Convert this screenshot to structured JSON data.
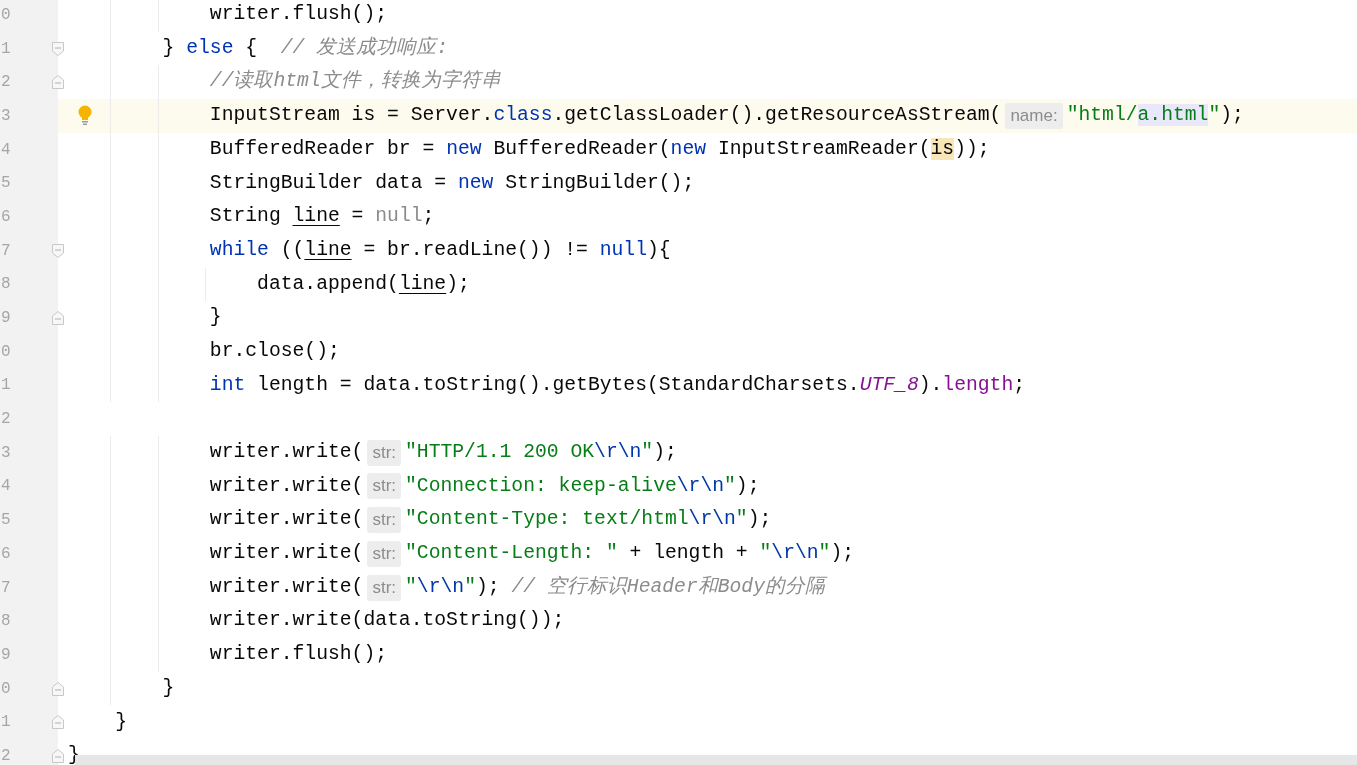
{
  "editor": {
    "lines": [
      {
        "number": "0",
        "highlighted": false,
        "bulb": false,
        "fold_start": false,
        "fold_end": false,
        "tokens": [
          {
            "kind": "plain",
            "text": "            writer.flush();"
          }
        ]
      },
      {
        "number": "1",
        "highlighted": false,
        "bulb": false,
        "fold_start": true,
        "fold_end": false,
        "tokens": [
          {
            "kind": "plain",
            "text": "        } "
          },
          {
            "kind": "keyword",
            "text": "else"
          },
          {
            "kind": "plain",
            "text": " {  "
          },
          {
            "kind": "comment",
            "text": "// 发送成功响应:"
          }
        ]
      },
      {
        "number": "2",
        "highlighted": false,
        "bulb": false,
        "fold_start": false,
        "fold_end": true,
        "tokens": [
          {
            "kind": "comment",
            "text": "            //读取html文件，转换为字符串"
          }
        ]
      },
      {
        "number": "3",
        "highlighted": true,
        "bulb": true,
        "fold_start": false,
        "fold_end": false,
        "tokens": [
          {
            "kind": "plain",
            "text": "            InputStream is = Server."
          },
          {
            "kind": "keyword",
            "text": "class"
          },
          {
            "kind": "plain",
            "text": ".getClassLoader().getResourceAsStream("
          },
          {
            "kind": "hint",
            "text": "name:"
          },
          {
            "kind": "string",
            "text": "\"html/"
          },
          {
            "kind": "match",
            "text": "a.html"
          },
          {
            "kind": "string",
            "text": "\""
          },
          {
            "kind": "plain",
            "text": ");"
          }
        ]
      },
      {
        "number": "4",
        "highlighted": false,
        "bulb": false,
        "fold_start": false,
        "fold_end": false,
        "tokens": [
          {
            "kind": "plain",
            "text": "            BufferedReader br = "
          },
          {
            "kind": "keyword",
            "text": "new"
          },
          {
            "kind": "plain",
            "text": " BufferedReader("
          },
          {
            "kind": "keyword",
            "text": "new"
          },
          {
            "kind": "plain",
            "text": " InputStreamReader("
          },
          {
            "kind": "usage",
            "text": "is"
          },
          {
            "kind": "plain",
            "text": "));"
          }
        ]
      },
      {
        "number": "5",
        "highlighted": false,
        "bulb": false,
        "fold_start": false,
        "fold_end": false,
        "tokens": [
          {
            "kind": "plain",
            "text": "            StringBuilder data = "
          },
          {
            "kind": "keyword",
            "text": "new"
          },
          {
            "kind": "plain",
            "text": " StringBuilder();"
          }
        ]
      },
      {
        "number": "6",
        "highlighted": false,
        "bulb": false,
        "fold_start": false,
        "fold_end": false,
        "tokens": [
          {
            "kind": "plain",
            "text": "            String "
          },
          {
            "kind": "reassigned",
            "text": "line"
          },
          {
            "kind": "plain",
            "text": " = "
          },
          {
            "kind": "redundant",
            "text": "null"
          },
          {
            "kind": "plain",
            "text": ";"
          }
        ]
      },
      {
        "number": "7",
        "highlighted": false,
        "bulb": false,
        "fold_start": true,
        "fold_end": false,
        "tokens": [
          {
            "kind": "keyword",
            "text": "            while"
          },
          {
            "kind": "plain",
            "text": " (("
          },
          {
            "kind": "reassigned",
            "text": "line"
          },
          {
            "kind": "plain",
            "text": " = br.readLine()) != "
          },
          {
            "kind": "keyword",
            "text": "null"
          },
          {
            "kind": "plain",
            "text": "){"
          }
        ]
      },
      {
        "number": "8",
        "highlighted": false,
        "bulb": false,
        "fold_start": false,
        "fold_end": false,
        "tokens": [
          {
            "kind": "plain",
            "text": "                data.append("
          },
          {
            "kind": "reassigned",
            "text": "line"
          },
          {
            "kind": "plain",
            "text": ");"
          }
        ]
      },
      {
        "number": "9",
        "highlighted": false,
        "bulb": false,
        "fold_start": false,
        "fold_end": true,
        "tokens": [
          {
            "kind": "plain",
            "text": "            }"
          }
        ]
      },
      {
        "number": "0",
        "highlighted": false,
        "bulb": false,
        "fold_start": false,
        "fold_end": false,
        "tokens": [
          {
            "kind": "plain",
            "text": "            br.close();"
          }
        ]
      },
      {
        "number": "1",
        "highlighted": false,
        "bulb": false,
        "fold_start": false,
        "fold_end": false,
        "tokens": [
          {
            "kind": "keyword",
            "text": "            int"
          },
          {
            "kind": "plain",
            "text": " length = data.toString().getBytes(StandardCharsets."
          },
          {
            "kind": "constant",
            "text": "UTF_8"
          },
          {
            "kind": "plain",
            "text": ")."
          },
          {
            "kind": "field",
            "text": "length"
          },
          {
            "kind": "plain",
            "text": ";"
          }
        ]
      },
      {
        "number": "2",
        "highlighted": false,
        "bulb": false,
        "fold_start": false,
        "fold_end": false
      },
      {
        "number": "3",
        "highlighted": false,
        "bulb": false,
        "fold_start": false,
        "fold_end": false,
        "tokens": [
          {
            "kind": "plain",
            "text": "            writer.write("
          },
          {
            "kind": "hint",
            "text": "str:"
          },
          {
            "kind": "string",
            "text": "\"HTTP/1.1 200 OK"
          },
          {
            "kind": "escape",
            "text": "\\r\\n"
          },
          {
            "kind": "string",
            "text": "\""
          },
          {
            "kind": "plain",
            "text": ");"
          }
        ]
      },
      {
        "number": "4",
        "highlighted": false,
        "bulb": false,
        "fold_start": false,
        "fold_end": false,
        "tokens": [
          {
            "kind": "plain",
            "text": "            writer.write("
          },
          {
            "kind": "hint",
            "text": "str:"
          },
          {
            "kind": "string",
            "text": "\"Connection: keep-alive"
          },
          {
            "kind": "escape",
            "text": "\\r\\n"
          },
          {
            "kind": "string",
            "text": "\""
          },
          {
            "kind": "plain",
            "text": ");"
          }
        ]
      },
      {
        "number": "5",
        "highlighted": false,
        "bulb": false,
        "fold_start": false,
        "fold_end": false,
        "tokens": [
          {
            "kind": "plain",
            "text": "            writer.write("
          },
          {
            "kind": "hint",
            "text": "str:"
          },
          {
            "kind": "string",
            "text": "\"Content-Type: text/html"
          },
          {
            "kind": "escape",
            "text": "\\r\\n"
          },
          {
            "kind": "string",
            "text": "\""
          },
          {
            "kind": "plain",
            "text": ");"
          }
        ]
      },
      {
        "number": "6",
        "highlighted": false,
        "bulb": false,
        "fold_start": false,
        "fold_end": false,
        "tokens": [
          {
            "kind": "plain",
            "text": "            writer.write("
          },
          {
            "kind": "hint",
            "text": "str:"
          },
          {
            "kind": "string",
            "text": "\"Content-Length: \""
          },
          {
            "kind": "plain",
            "text": " + length + "
          },
          {
            "kind": "string",
            "text": "\""
          },
          {
            "kind": "escape",
            "text": "\\r\\n"
          },
          {
            "kind": "string",
            "text": "\""
          },
          {
            "kind": "plain",
            "text": ");"
          }
        ]
      },
      {
        "number": "7",
        "highlighted": false,
        "bulb": false,
        "fold_start": false,
        "fold_end": false,
        "tokens": [
          {
            "kind": "plain",
            "text": "            writer.write("
          },
          {
            "kind": "hint",
            "text": "str:"
          },
          {
            "kind": "string",
            "text": "\""
          },
          {
            "kind": "escape",
            "text": "\\r\\n"
          },
          {
            "kind": "string",
            "text": "\""
          },
          {
            "kind": "plain",
            "text": "); "
          },
          {
            "kind": "comment",
            "text": "// 空行标识Header和Body的分隔"
          }
        ]
      },
      {
        "number": "8",
        "highlighted": false,
        "bulb": false,
        "fold_start": false,
        "fold_end": false,
        "tokens": [
          {
            "kind": "plain",
            "text": "            writer.write(data.toString());"
          }
        ]
      },
      {
        "number": "9",
        "highlighted": false,
        "bulb": false,
        "fold_start": false,
        "fold_end": false,
        "tokens": [
          {
            "kind": "plain",
            "text": "            writer.flush();"
          }
        ]
      },
      {
        "number": "0",
        "highlighted": false,
        "bulb": false,
        "fold_start": false,
        "fold_end": true,
        "tokens": [
          {
            "kind": "plain",
            "text": "        }"
          }
        ]
      },
      {
        "number": "1",
        "highlighted": false,
        "bulb": false,
        "fold_start": false,
        "fold_end": true,
        "tokens": [
          {
            "kind": "plain",
            "text": "    }"
          }
        ]
      },
      {
        "number": "2",
        "highlighted": false,
        "bulb": false,
        "fold_start": false,
        "fold_end": true,
        "tokens": [
          {
            "kind": "plain",
            "text": "}"
          }
        ]
      }
    ]
  }
}
